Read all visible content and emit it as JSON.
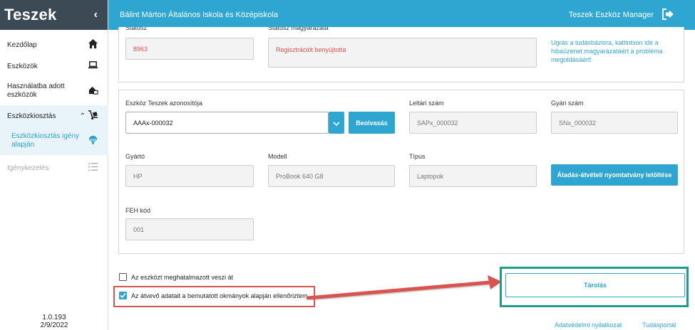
{
  "sidebar": {
    "brand": "Teszek",
    "items": [
      {
        "label": "Kezdőlap",
        "icon": "home-icon"
      },
      {
        "label": "Eszközök",
        "icon": "laptop-icon"
      },
      {
        "label": "Használatba adott eszközök",
        "icon": "handover-icon"
      },
      {
        "label": "Eszközkiosztás",
        "icon": "dolly-icon"
      },
      {
        "label": "Eszközkiosztás igény alapján",
        "icon": "parachute-icon"
      },
      {
        "label": "Igénykezelés",
        "icon": "list-icon"
      }
    ],
    "version": "1.0.193",
    "date": "2/9/2022"
  },
  "topbar": {
    "school": "Bálint Márton Általános Iskola és Középiskola",
    "app": "Teszek Eszköz Manager"
  },
  "status": {
    "label": "Státusz",
    "value": "8963",
    "desc_label": "Státusz magyarázata",
    "desc_value": "Regisztrációt benyújtotta",
    "hint": "Ugrás a tudásbázisra, kattintson ide a hibaüzenet magyarázatáért a probléma megoldásáért!"
  },
  "device": {
    "id_label": "Eszköz Teszek azonosítója",
    "id_value": "AAAx-000032",
    "scan_button": "Beolvasás",
    "inventory_label": "Leltári szám",
    "inventory_value": "SAPx_000032",
    "serial_label": "Gyári szám",
    "serial_value": "SNx_000032",
    "maker_label": "Gyártó",
    "maker_value": "HP",
    "model_label": "Modell",
    "model_value": "ProBook 640 G8",
    "type_label": "Típus",
    "type_value": "Laptopok",
    "download_button": "Átadás-átvételi nyomtatvány letöltése",
    "feh_label": "FEH kód",
    "feh_value": "001"
  },
  "checks": {
    "proxy": {
      "label": "Az eszközt meghatalmazott veszi át",
      "checked": false
    },
    "verified": {
      "label": "Az átvevő adatait a bemutatott okmányok alapján ellenőriztem",
      "checked": true
    }
  },
  "actions": {
    "store_button": "Tárolás"
  },
  "footer": {
    "privacy": "Adatvédelmi nyilatkozat",
    "portal": "Tudásportál"
  },
  "colors": {
    "accent": "#2ea6d1",
    "sidebar_dark": "#3c4a55",
    "annotation_red": "#d9534f",
    "annotation_green": "#1c9c8a"
  }
}
